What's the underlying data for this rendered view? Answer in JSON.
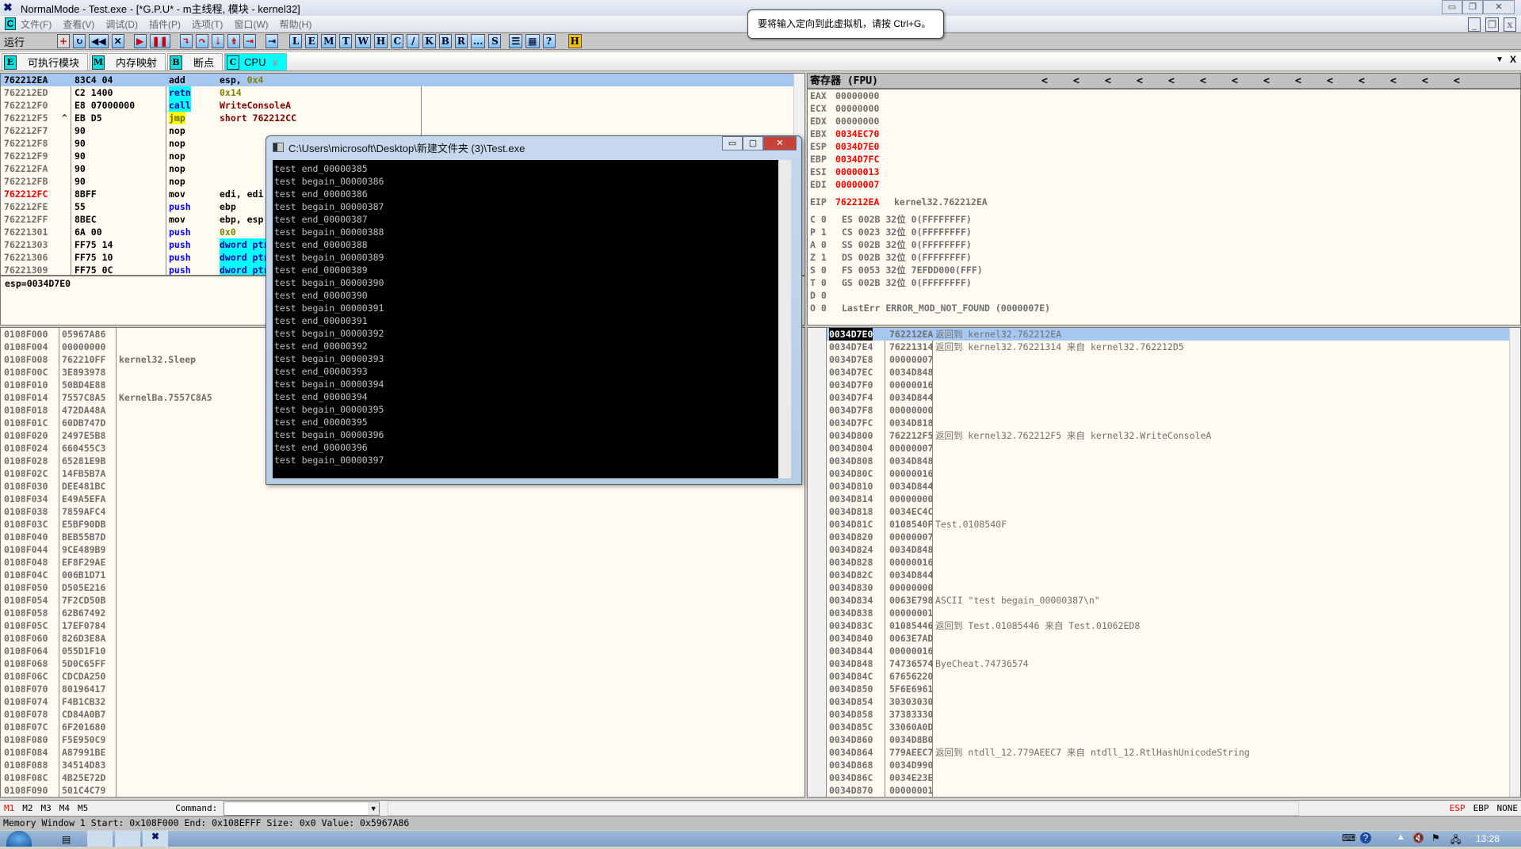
{
  "window": {
    "title": "NormalMode - Test.exe - [*G.P.U* - m主线程, 模块 - kernel32]"
  },
  "menu": {
    "items": [
      "文件(F)",
      "查看(V)",
      "调试(D)",
      "插件(P)",
      "选项(T)",
      "窗口(W)",
      "帮助(H)"
    ]
  },
  "toolbar": {
    "status": "运行",
    "letters": [
      "L",
      "E",
      "M",
      "T",
      "W",
      "H",
      "C",
      "/",
      "K",
      "B",
      "R",
      "...",
      "S"
    ],
    "h_label": "H"
  },
  "tabs": [
    {
      "key": "E",
      "label": "可执行模块"
    },
    {
      "key": "M",
      "label": "内存映射"
    },
    {
      "key": "B",
      "label": "断点"
    },
    {
      "key": "C",
      "label": "CPU",
      "active": true
    }
  ],
  "tooltip": "要将输入定向到此虚拟机，请按 Ctrl+G。",
  "disasm": [
    {
      "addr": "762212EA",
      "mark": "",
      "hex": "83C4 04",
      "mnem": "add",
      "ops": "esp, 0x4",
      "selected": true
    },
    {
      "addr": "762212ED",
      "mark": "",
      "hex": "C2 1400",
      "mnem": "retn",
      "ops": "0x14",
      "mstyle": "cyan",
      "ostyle": "olive"
    },
    {
      "addr": "762212F0",
      "mark": "",
      "hex": "E8 07000000",
      "mnem": "call",
      "ops": "WriteConsoleA",
      "mstyle": "cyan",
      "ostyle": "maroon"
    },
    {
      "addr": "762212F5",
      "mark": "^",
      "hex": "EB D5",
      "mnem": "jmp",
      "ops": "short 762212CC",
      "mstyle": "yel",
      "ostyle": "maroon"
    },
    {
      "addr": "762212F7",
      "mark": "",
      "hex": "90",
      "mnem": "nop",
      "ops": ""
    },
    {
      "addr": "762212F8",
      "mark": "",
      "hex": "90",
      "mnem": "nop",
      "ops": ""
    },
    {
      "addr": "762212F9",
      "mark": "",
      "hex": "90",
      "mnem": "nop",
      "ops": ""
    },
    {
      "addr": "762212FA",
      "mark": "",
      "hex": "90",
      "mnem": "nop",
      "ops": ""
    },
    {
      "addr": "762212FB",
      "mark": "",
      "hex": "90",
      "mnem": "nop",
      "ops": ""
    },
    {
      "addr": "762212FC",
      "mark": "",
      "hex": "8BFF",
      "mnem": "mov",
      "ops": "edi, edi",
      "astyle": "red"
    },
    {
      "addr": "762212FE",
      "mark": "",
      "hex": "55",
      "mnem": "push",
      "ops": "ebp",
      "mstyle": "blue"
    },
    {
      "addr": "762212FF",
      "mark": "",
      "hex": "8BEC",
      "mnem": "mov",
      "ops": "ebp, esp"
    },
    {
      "addr": "76221301",
      "mark": "",
      "hex": "6A 00",
      "mnem": "push",
      "ops": "0x0",
      "mstyle": "blue",
      "ostyle": "olive"
    },
    {
      "addr": "76221303",
      "mark": "",
      "hex": "FF75 14",
      "mnem": "push",
      "ops": "dword ptr",
      "mstyle": "blue",
      "ostyle": "cyan"
    },
    {
      "addr": "76221306",
      "mark": "",
      "hex": "FF75 10",
      "mnem": "push",
      "ops": "dword ptr",
      "mstyle": "blue",
      "ostyle": "cyan"
    },
    {
      "addr": "76221309",
      "mark": "",
      "hex": "FF75 0C",
      "mnem": "push",
      "ops": "dword ptr",
      "mstyle": "blue",
      "ostyle": "cyan"
    }
  ],
  "info": "esp=0034D7E0",
  "registers": {
    "title": "寄存器 (FPU)",
    "gp": [
      {
        "name": "EAX",
        "value": "00000000"
      },
      {
        "name": "ECX",
        "value": "00000000"
      },
      {
        "name": "EDX",
        "value": "00000000"
      },
      {
        "name": "EBX",
        "value": "0034EC70",
        "changed": true
      },
      {
        "name": "ESP",
        "value": "0034D7E0",
        "changed": true
      },
      {
        "name": "EBP",
        "value": "0034D7FC",
        "changed": true
      },
      {
        "name": "ESI",
        "value": "00000013",
        "changed": true
      },
      {
        "name": "EDI",
        "value": "00000007",
        "changed": true
      }
    ],
    "eip": {
      "name": "EIP",
      "value": "762212EA",
      "comment": "kernel32.762212EA"
    },
    "flags": [
      {
        "flag": "C 0",
        "seg": "ES 002B 32位 0(FFFFFFFF)"
      },
      {
        "flag": "P 1",
        "seg": "CS 0023 32位 0(FFFFFFFF)"
      },
      {
        "flag": "A 0",
        "seg": "SS 002B 32位 0(FFFFFFFF)"
      },
      {
        "flag": "Z 1",
        "seg": "DS 002B 32位 0(FFFFFFFF)"
      },
      {
        "flag": "S 0",
        "seg": "FS 0053 32位 7EFDD000(FFF)"
      },
      {
        "flag": "T 0",
        "seg": "GS 002B 32位 0(FFFFFFFF)"
      },
      {
        "flag": "D 0",
        "seg": ""
      },
      {
        "flag": "O 0",
        "seg": "LastErr ERROR_MOD_NOT_FOUND (0000007E)"
      }
    ]
  },
  "memory": [
    [
      "0108F000",
      "05967A86",
      ""
    ],
    [
      "0108F004",
      "00000000",
      ""
    ],
    [
      "0108F008",
      "762210FF",
      "kernel32.Sleep"
    ],
    [
      "0108F00C",
      "3E893978",
      ""
    ],
    [
      "0108F010",
      "50BD4E88",
      ""
    ],
    [
      "0108F014",
      "7557C8A5",
      "KernelBa.7557C8A5"
    ],
    [
      "0108F018",
      "472DA48A",
      ""
    ],
    [
      "0108F01C",
      "60DB747D",
      ""
    ],
    [
      "0108F020",
      "2497E5B8",
      ""
    ],
    [
      "0108F024",
      "660455C3",
      ""
    ],
    [
      "0108F028",
      "65281E9B",
      ""
    ],
    [
      "0108F02C",
      "14FB5B7A",
      ""
    ],
    [
      "0108F030",
      "DEE481BC",
      ""
    ],
    [
      "0108F034",
      "E49A5EFA",
      ""
    ],
    [
      "0108F038",
      "7859AFC4",
      ""
    ],
    [
      "0108F03C",
      "E5BF90DB",
      ""
    ],
    [
      "0108F040",
      "BEB55B7D",
      ""
    ],
    [
      "0108F044",
      "9CE489B9",
      ""
    ],
    [
      "0108F048",
      "EF8F29AE",
      ""
    ],
    [
      "0108F04C",
      "006B1D71",
      ""
    ],
    [
      "0108F050",
      "D505E216",
      ""
    ],
    [
      "0108F054",
      "7F2CD50B",
      ""
    ],
    [
      "0108F058",
      "62B67492",
      ""
    ],
    [
      "0108F05C",
      "17EF0784",
      ""
    ],
    [
      "0108F060",
      "826D3E8A",
      ""
    ],
    [
      "0108F064",
      "055D1F10",
      ""
    ],
    [
      "0108F068",
      "5D0C65FF",
      ""
    ],
    [
      "0108F06C",
      "CDCDA250",
      ""
    ],
    [
      "0108F070",
      "80196417",
      ""
    ],
    [
      "0108F074",
      "F4B1CB32",
      ""
    ],
    [
      "0108F078",
      "CD84A0B7",
      ""
    ],
    [
      "0108F07C",
      "6F201680",
      ""
    ],
    [
      "0108F080",
      "F5E950C9",
      ""
    ],
    [
      "0108F084",
      "A87991BE",
      ""
    ],
    [
      "0108F088",
      "34514D83",
      ""
    ],
    [
      "0108F08C",
      "4B25E72D",
      ""
    ],
    [
      "0108F090",
      "501C4C79",
      ""
    ]
  ],
  "stack": [
    [
      "0034D7E0",
      "762212EA",
      "返回到 kernel32.762212EA"
    ],
    [
      "0034D7E4",
      "76221314",
      "返回到 kernel32.76221314 来自 kernel32.762212D5"
    ],
    [
      "0034D7E8",
      "00000007",
      ""
    ],
    [
      "0034D7EC",
      "0034D848",
      ""
    ],
    [
      "0034D7F0",
      "00000016",
      ""
    ],
    [
      "0034D7F4",
      "0034D844",
      ""
    ],
    [
      "0034D7F8",
      "00000000",
      ""
    ],
    [
      "0034D7FC",
      "0034D818",
      ""
    ],
    [
      "0034D800",
      "762212F5",
      "返回到 kernel32.762212F5 来自 kernel32.WriteConsoleA"
    ],
    [
      "0034D804",
      "00000007",
      ""
    ],
    [
      "0034D808",
      "0034D848",
      ""
    ],
    [
      "0034D80C",
      "00000016",
      ""
    ],
    [
      "0034D810",
      "0034D844",
      ""
    ],
    [
      "0034D814",
      "00000000",
      ""
    ],
    [
      "0034D818",
      "0034EC4C",
      ""
    ],
    [
      "0034D81C",
      "0108540F",
      "Test.0108540F"
    ],
    [
      "0034D820",
      "00000007",
      ""
    ],
    [
      "0034D824",
      "0034D848",
      ""
    ],
    [
      "0034D828",
      "00000016",
      ""
    ],
    [
      "0034D82C",
      "0034D844",
      ""
    ],
    [
      "0034D830",
      "00000000",
      ""
    ],
    [
      "0034D834",
      "0063E798",
      "ASCII \"test begain_00000387\\n\""
    ],
    [
      "0034D838",
      "00000001",
      ""
    ],
    [
      "0034D83C",
      "01085446",
      "返回到 Test.01085446 来自 Test.01062ED8"
    ],
    [
      "0034D840",
      "0063E7AD",
      ""
    ],
    [
      "0034D844",
      "00000016",
      ""
    ],
    [
      "0034D848",
      "74736574",
      "ByeCheat.74736574"
    ],
    [
      "0034D84C",
      "67656220",
      ""
    ],
    [
      "0034D850",
      "5F6E6961",
      ""
    ],
    [
      "0034D854",
      "30303030",
      ""
    ],
    [
      "0034D858",
      "37383330",
      ""
    ],
    [
      "0034D85C",
      "33060A0D",
      ""
    ],
    [
      "0034D860",
      "0034D8B0",
      ""
    ],
    [
      "0034D864",
      "779AEEC7",
      "返回到 ntdll_12.779AEEC7 来自 ntdll_12.RtlHashUnicodeString"
    ],
    [
      "0034D868",
      "0034D990",
      ""
    ],
    [
      "0034D86C",
      "0034E23E",
      ""
    ],
    [
      "0034D870",
      "00000001",
      ""
    ]
  ],
  "console": {
    "title": "C:\\Users\\microsoft\\Desktop\\新建文件夹 (3)\\Test.exe",
    "lines": [
      "test end_00000385",
      "test begain_00000386",
      "test end_00000386",
      "test begain_00000387",
      "test end_00000387",
      "test begain_00000388",
      "test end_00000388",
      "test begain_00000389",
      "test end_00000389",
      "test begain_00000390",
      "test end_00000390",
      "test begain_00000391",
      "test end_00000391",
      "test begain_00000392",
      "test end_00000392",
      "test begain_00000393",
      "test end_00000393",
      "test begain_00000394",
      "test end_00000394",
      "test begain_00000395",
      "test end_00000395",
      "test begain_00000396",
      "test end_00000396",
      "test begain_00000397"
    ]
  },
  "bottom": {
    "mem_tabs": [
      "M1",
      "M2",
      "M3",
      "M4",
      "M5"
    ],
    "command_label": "Command:",
    "command_value": "",
    "stack_modes": [
      "ESP",
      "EBP",
      "NONE"
    ]
  },
  "status": "Memory Window 1  Start: 0x108F000  End: 0x108EFFF  Size: 0x0 Value: 0x5967A86",
  "taskbar": {
    "clock": "13:28"
  }
}
